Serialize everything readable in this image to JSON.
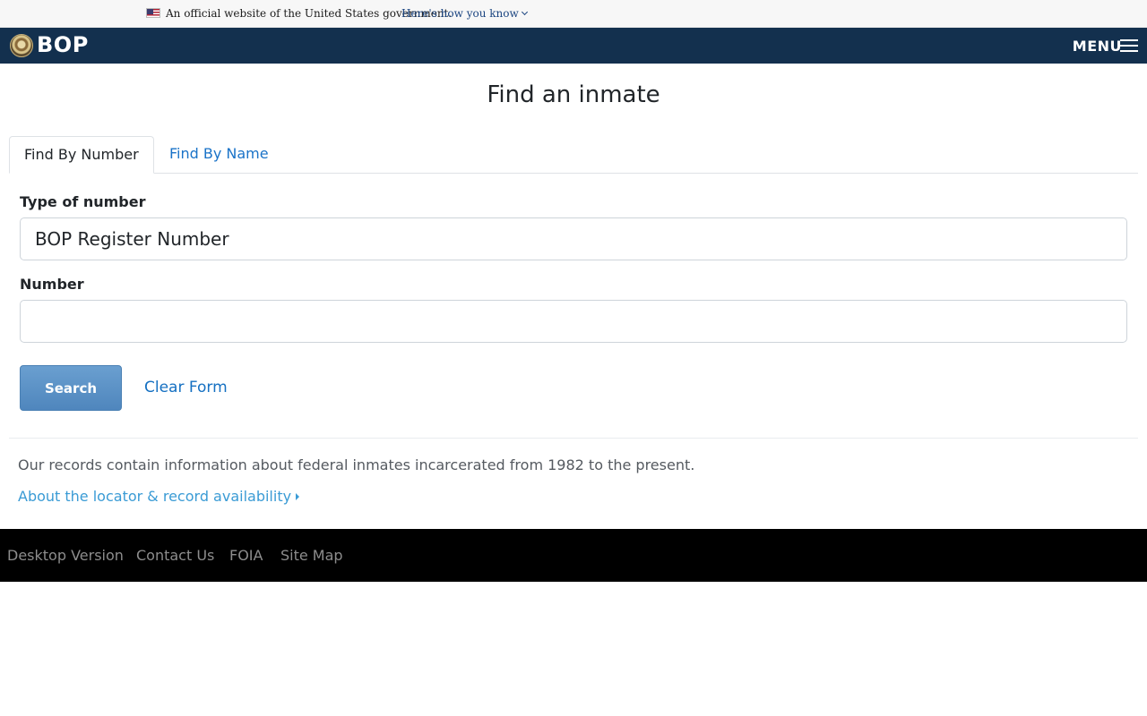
{
  "gov_banner": {
    "text": "An official website of the United States government.",
    "link": "Here's how you know",
    "flag_icon": "us-flag-icon"
  },
  "header": {
    "logo_text": "BOP",
    "menu_label": "MENU",
    "brand_color": "#13304e"
  },
  "main": {
    "title": "Find an inmate",
    "tabs": [
      {
        "label": "Find By Number",
        "active": true
      },
      {
        "label": "Find By Name",
        "active": false
      }
    ],
    "form": {
      "type_label": "Type of number",
      "type_value": "BOP Register Number",
      "number_label": "Number",
      "number_value": "",
      "number_placeholder": "",
      "search_label": "Search",
      "clear_label": "Clear Form"
    },
    "records_note": "Our records contain information about federal inmates incarcerated from 1982 to the present.",
    "about_link": "About the locator & record availability"
  },
  "footer": {
    "links": [
      "Desktop Version",
      "Contact Us",
      "FOIA",
      "Site Map"
    ]
  },
  "colors": {
    "link": "#1570c2",
    "button": "#5b8fc6",
    "footer_bg": "#000000"
  }
}
